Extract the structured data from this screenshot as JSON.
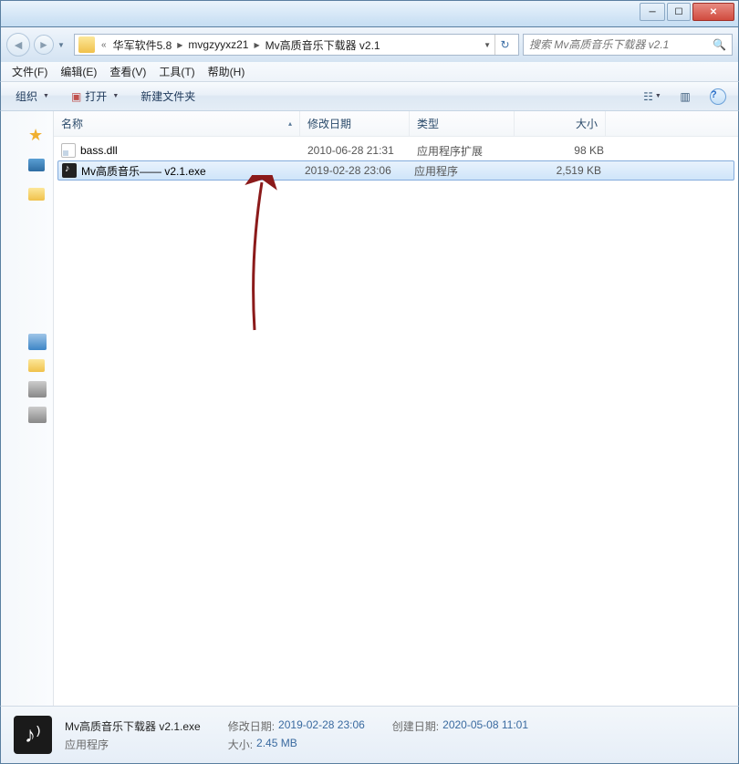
{
  "breadcrumb": {
    "prefix": "«",
    "items": [
      "华军软件5.8",
      "mvgzyyxz21",
      "Mv高质音乐下载器 v2.1"
    ]
  },
  "search": {
    "placeholder": "搜索 Mv高质音乐下载器 v2.1"
  },
  "menu": {
    "file": "文件(F)",
    "edit": "编辑(E)",
    "view": "查看(V)",
    "tools": "工具(T)",
    "help": "帮助(H)"
  },
  "toolbar": {
    "organize": "组织",
    "open": "打开",
    "newfolder": "新建文件夹"
  },
  "columns": {
    "name": "名称",
    "date": "修改日期",
    "type": "类型",
    "size": "大小"
  },
  "files": [
    {
      "name": "bass.dll",
      "date": "2010-06-28 21:31",
      "type": "应用程序扩展",
      "size": "98 KB",
      "icon": "dll",
      "selected": false
    },
    {
      "name": "Mv高质音乐——    v2.1.exe",
      "date": "2019-02-28 23:06",
      "type": "应用程序",
      "size": "2,519 KB",
      "icon": "exe",
      "selected": true
    }
  ],
  "details": {
    "title": "Mv高质音乐下载器 v2.1.exe",
    "sub": "应用程序",
    "mod_label": "修改日期:",
    "mod_val": "2019-02-28 23:06",
    "size_label": "大小:",
    "size_val": "2.45 MB",
    "create_label": "创建日期:",
    "create_val": "2020-05-08 11:01"
  }
}
